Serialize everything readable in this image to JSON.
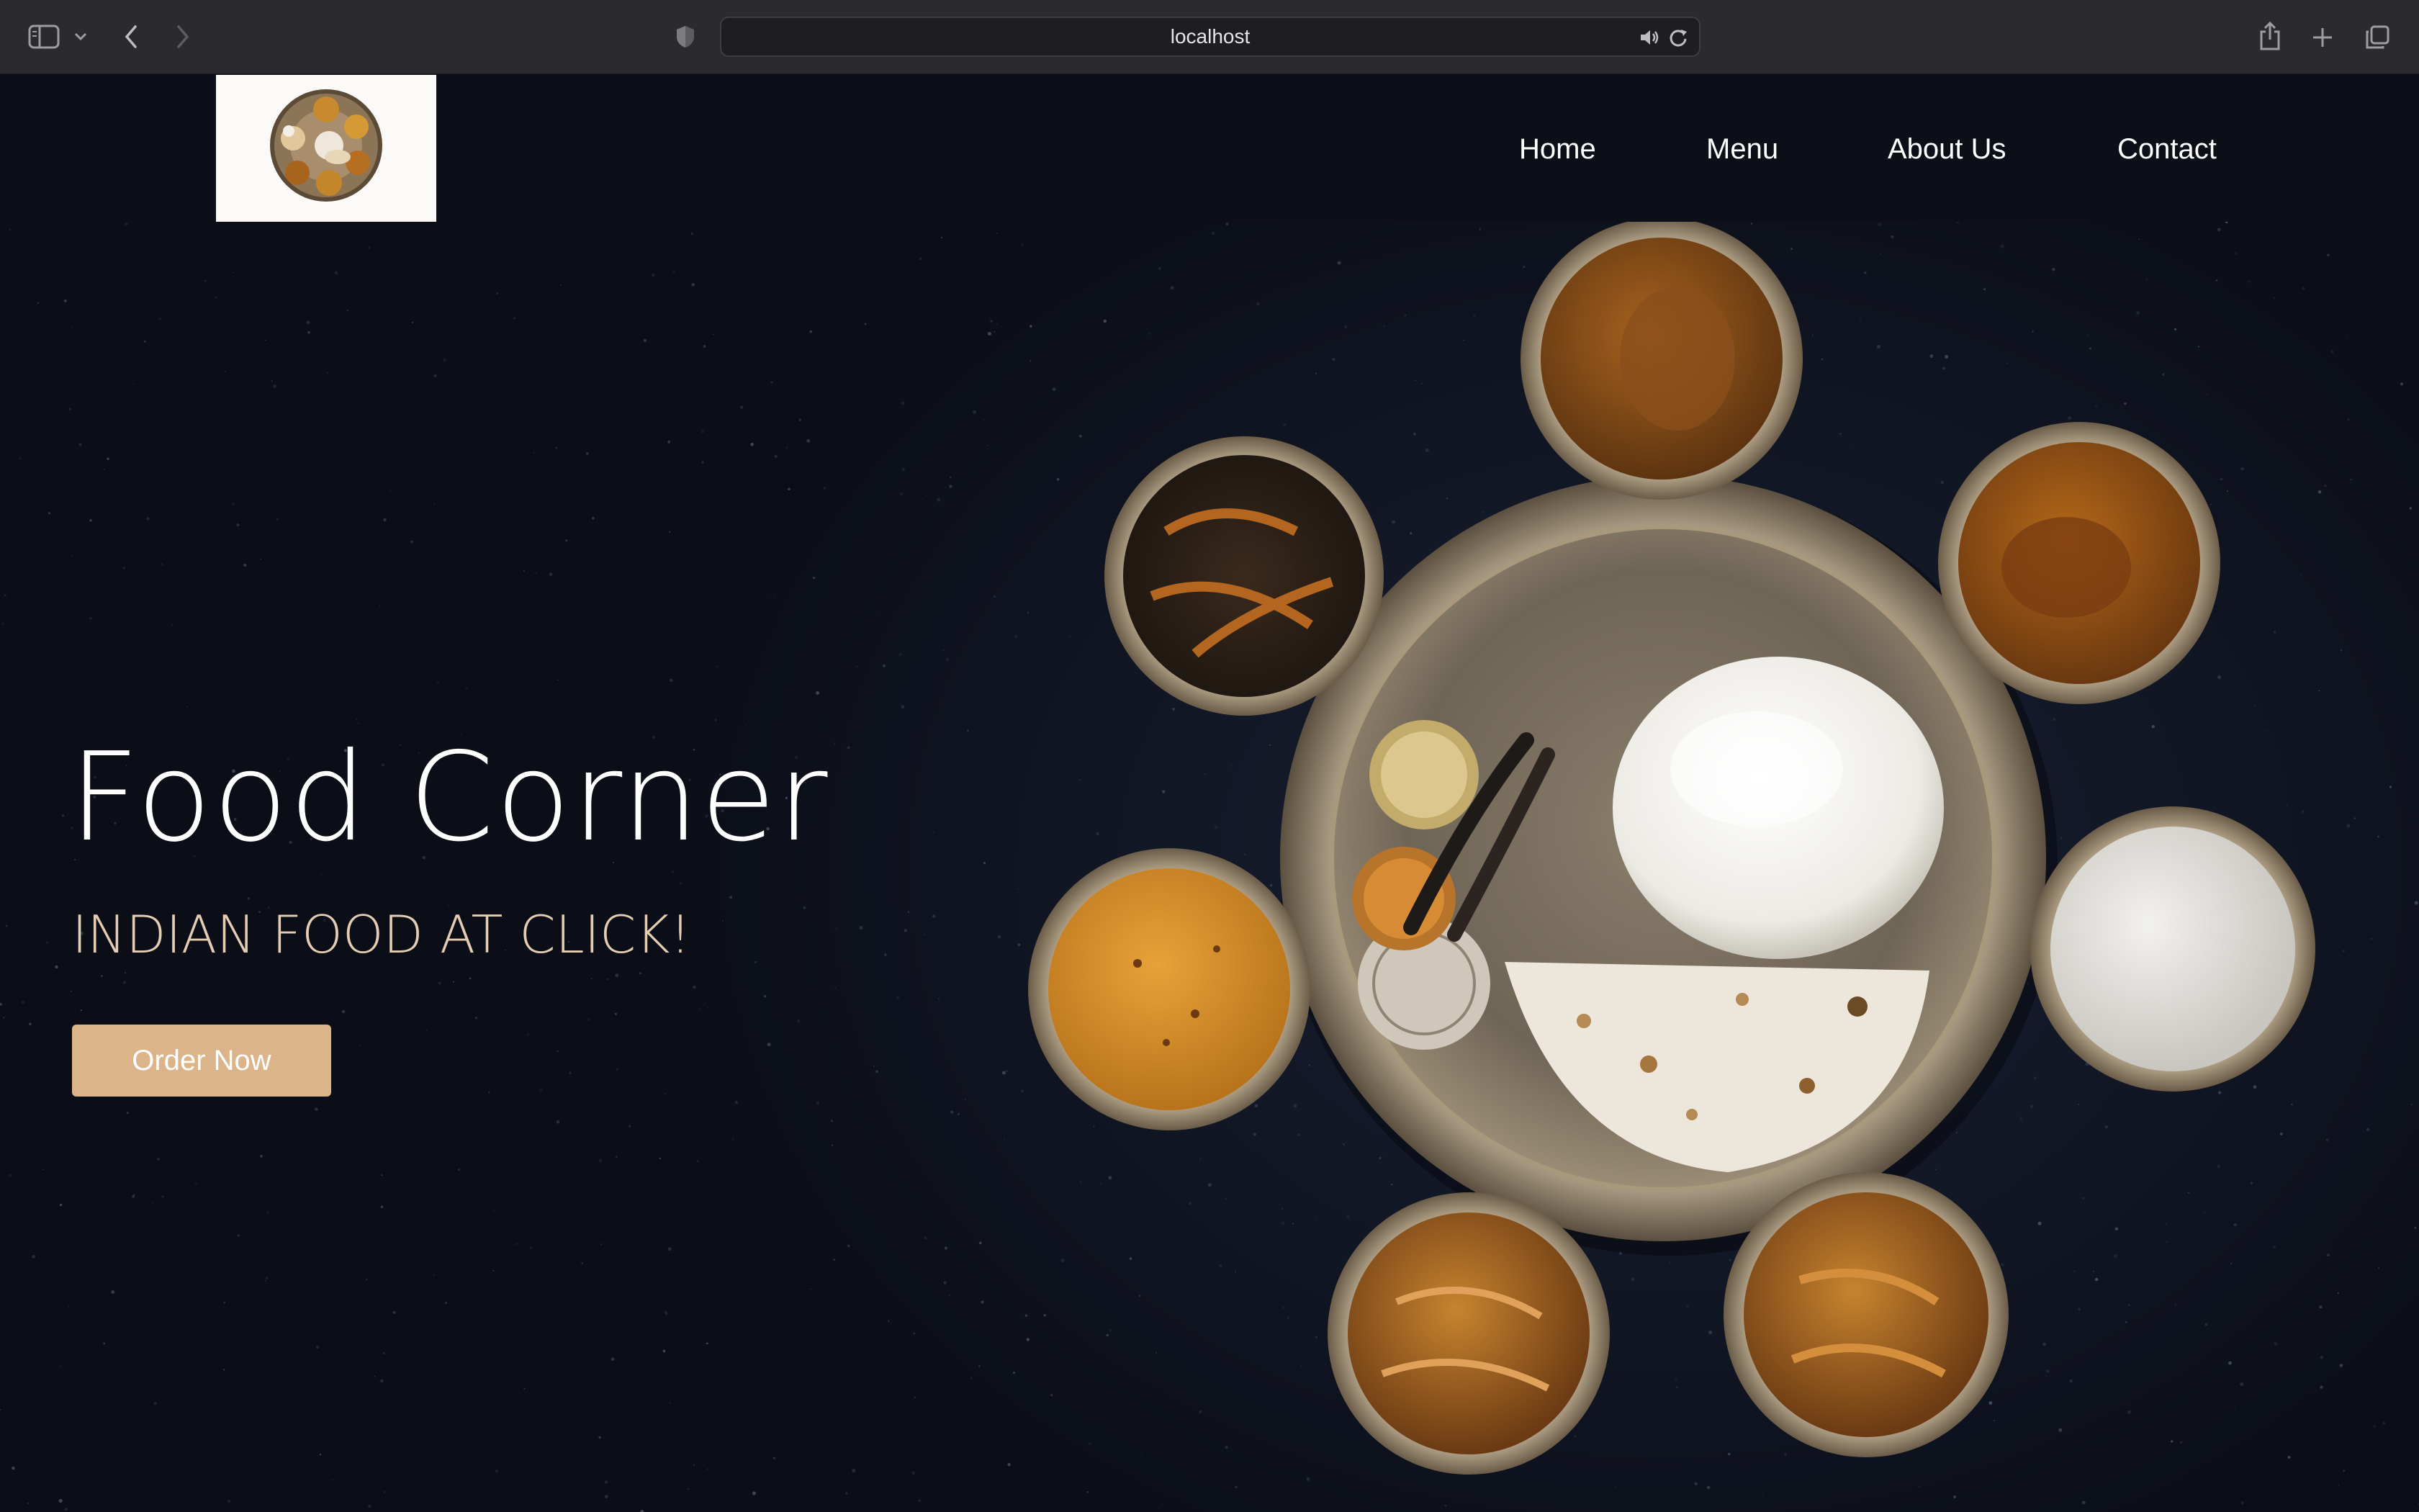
{
  "browser": {
    "url": "localhost",
    "icons": {
      "sidebar": "sidebar-icon",
      "back": "chevron-left-icon",
      "forward": "chevron-right-icon",
      "shield": "shield-icon",
      "audio": "speaker-icon",
      "reload": "reload-icon",
      "share": "share-icon",
      "new_tab": "plus-icon",
      "tabs": "tabs-overview-icon"
    }
  },
  "nav": {
    "logo_alt": "thali-logo",
    "links": [
      "Home",
      "Menu",
      "About Us",
      "Contact"
    ]
  },
  "hero": {
    "title": "Food Corner",
    "subtitle": "INDIAN FOOD AT CLICK!",
    "cta_label": "Order Now",
    "image": "indian-thali-photo"
  },
  "colors": {
    "nav_bg": "#0c0f18",
    "hero_bg": "#151a29",
    "accent": "#dbb48a",
    "subtitle": "#e4cdb3"
  }
}
